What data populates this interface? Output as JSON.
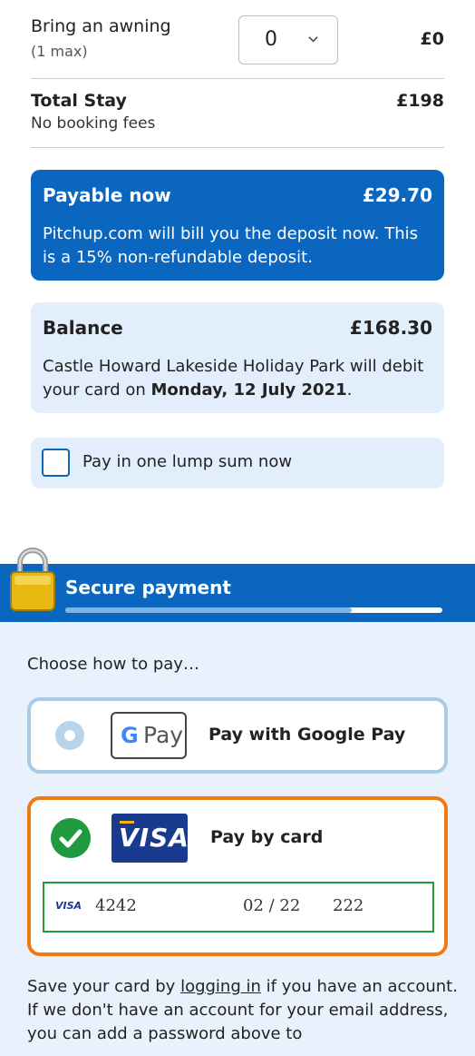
{
  "awning": {
    "label": "Bring an awning",
    "sub": "(1 max)",
    "selected": "0",
    "price": "£0"
  },
  "total": {
    "label": "Total Stay",
    "sub": "No booking fees",
    "price": "£198"
  },
  "payable_now": {
    "title": "Payable now",
    "amount": "£29.70",
    "text": "Pitchup.com will bill you the deposit now. This is a 15% non-refundable deposit."
  },
  "balance": {
    "title": "Balance",
    "amount": "£168.30",
    "text_pre": "Castle Howard Lakeside Holiday Park will debit your card on ",
    "text_bold": "Monday, 12 July 2021",
    "text_post": "."
  },
  "lump_sum": {
    "label": "Pay in one lump sum now",
    "checked": false
  },
  "secure": {
    "title": "Secure payment",
    "progress": 0.76
  },
  "payment": {
    "prompt": "Choose how to pay…",
    "google_pay": {
      "badge_g": "G",
      "badge_pay": "Pay",
      "label": "Pay with Google Pay",
      "selected": false
    },
    "card": {
      "badge": "VISA",
      "label": "Pay by card",
      "selected": true,
      "field": {
        "brand": "VISA",
        "number": "4242",
        "expiry": "02 / 22",
        "cvc": "222"
      }
    },
    "save_note": {
      "pre": "Save your card by ",
      "link": "logging in",
      "post": " if you have an account. If we don't have an account for your email address, you can add a password above to"
    }
  },
  "colors": {
    "primary": "#0a66bf",
    "light": "#e2eefb",
    "accent": "#f07a12",
    "success": "#1f9a3f"
  }
}
